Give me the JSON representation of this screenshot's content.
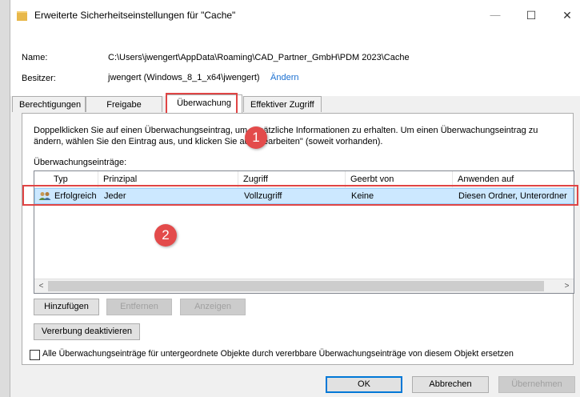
{
  "window": {
    "title": "Erweiterte Sicherheitseinstellungen für \"Cache\"",
    "min": "—",
    "max": "☐",
    "close": "✕"
  },
  "header": {
    "name_label": "Name:",
    "name_value": "C:\\Users\\jwengert\\AppData\\Roaming\\CAD_Partner_GmbH\\PDM 2023\\Cache",
    "owner_label": "Besitzer:",
    "owner_value": "jwengert (Windows_8_1_x64\\jwengert)",
    "owner_change": "Ändern"
  },
  "tabs": [
    "Berechtigungen",
    "Freigabe",
    "Überwachung",
    "Effektiver Zugriff"
  ],
  "description": "Doppelklicken Sie auf einen Überwachungseintrag, um zusätzliche Informationen zu erhalten. Um einen Überwachungseintrag zu ändern, wählen Sie den Eintrag aus, und klicken Sie auf \"Bearbeiten\" (soweit vorhanden).",
  "list_label": "Überwachungseinträge:",
  "columns": [
    "Typ",
    "Prinzipal",
    "Zugriff",
    "Geerbt von",
    "Anwenden auf"
  ],
  "rows": [
    {
      "typ": "Erfolgreich",
      "prinzipal": "Jeder",
      "zugriff": "Vollzugriff",
      "geerbt": "Keine",
      "anwenden": "Diesen Ordner, Unterordner"
    }
  ],
  "buttons": {
    "add": "Hinzufügen",
    "remove": "Entfernen",
    "view": "Anzeigen",
    "disable_inheritance": "Vererbung deaktivieren",
    "ok": "OK",
    "cancel": "Abbrechen",
    "apply": "Übernehmen"
  },
  "checkbox_label": "Alle Überwachungseinträge für untergeordnete Objekte durch vererbbare Überwachungseinträge von diesem Objekt ersetzen",
  "scroll": {
    "left": "<",
    "right": ">"
  },
  "annotations": [
    "1",
    "2"
  ],
  "colors": {
    "annotation": "#e34b4b",
    "selection": "#cce8ff",
    "link": "#1a6fd1"
  }
}
